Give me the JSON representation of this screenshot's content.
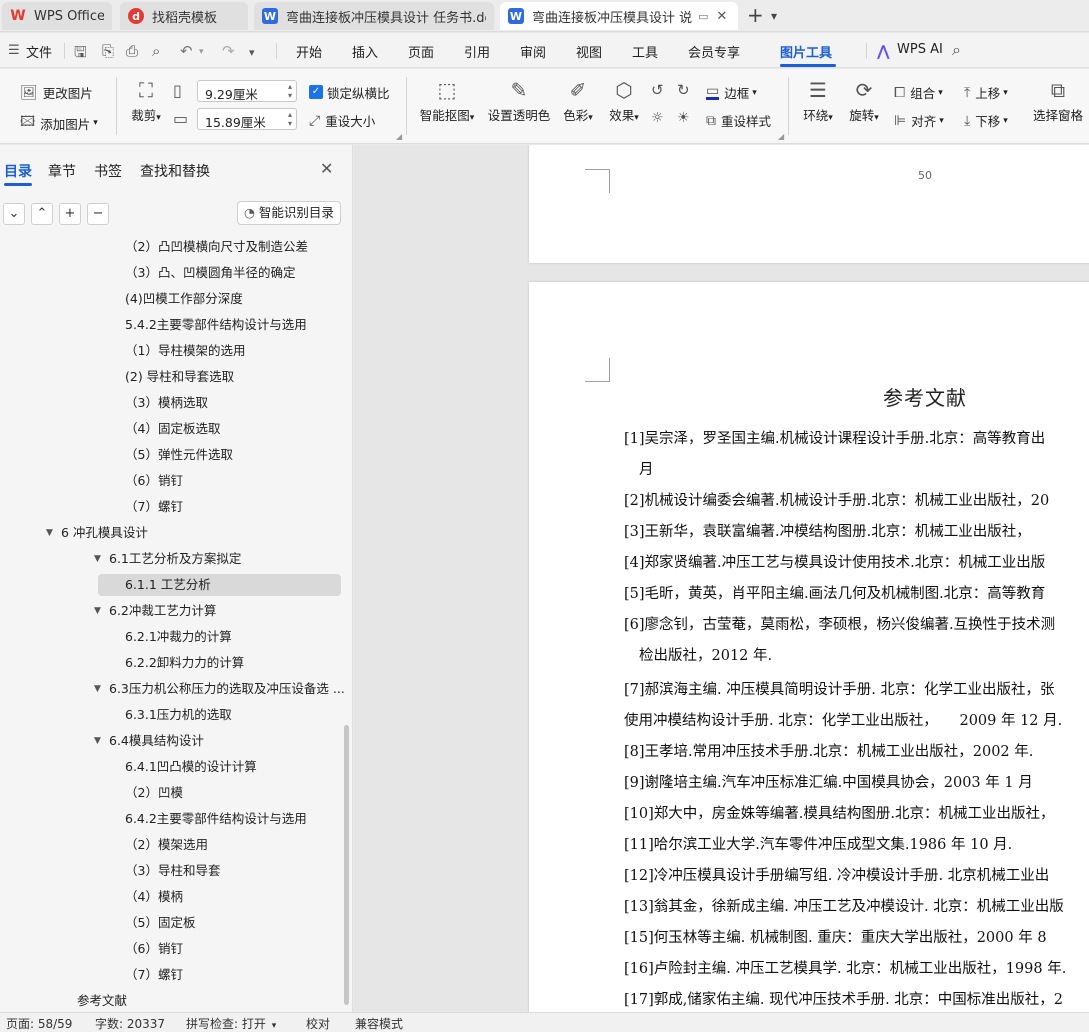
{
  "tabs": [
    {
      "label": "WPS Office",
      "icon": "wps-logo-icon"
    },
    {
      "label": "找稻壳模板",
      "icon": "docer-icon"
    },
    {
      "label": "弯曲连接板冲压模具设计 任务书.doc",
      "icon": "writer-icon"
    },
    {
      "label": "弯曲连接板冲压模具设计 说明",
      "icon": "writer-icon"
    }
  ],
  "titlebar": {
    "new_tab": "+",
    "dropdown": "▾"
  },
  "menu": {
    "file": "文件",
    "items": [
      "开始",
      "插入",
      "页面",
      "引用",
      "审阅",
      "视图",
      "工具",
      "会员专享",
      "图片工具"
    ],
    "active": "图片工具",
    "wps_ai": "WPS AI"
  },
  "ribbon": {
    "change_picture": "更改图片",
    "add_picture": "添加图片",
    "crop": "裁剪",
    "width_value": "9.29厘米",
    "height_value": "15.89厘米",
    "lock_ratio": "锁定纵横比",
    "reset_size": "重设大小",
    "smart_cutout": "智能抠图",
    "set_transparent": "设置透明色",
    "color": "色彩",
    "effects": "效果",
    "border": "边框",
    "reset_style": "重设样式",
    "wrap": "环绕",
    "rotate": "旋转",
    "group": "组合",
    "align": "对齐",
    "bring_forward": "上移",
    "send_backward": "下移",
    "selection_pane": "选择窗格"
  },
  "nav": {
    "tabs": [
      "目录",
      "章节",
      "书签",
      "查找和替换"
    ],
    "smart_toc": "智能识别目录",
    "toc": [
      {
        "text": "（2）凸凹模横向尺寸及制造公差"
      },
      {
        "text": "（3）凸、凹模圆角半径的确定"
      },
      {
        "text": "(4)凹模工作部分深度"
      },
      {
        "text": "5.4.2主要零部件结构设计与选用"
      },
      {
        "text": "（1）导柱模架的选用"
      },
      {
        "text": "(2) 导柱和导套选取"
      },
      {
        "text": "（3）模柄选取"
      },
      {
        "text": "（4）固定板选取"
      },
      {
        "text": "（5）弹性元件选取"
      },
      {
        "text": "（6）销钉"
      },
      {
        "text": "（7）螺钉"
      },
      {
        "text": "6 冲孔模具设计"
      },
      {
        "text": "6.1工艺分析及方案拟定"
      },
      {
        "text": "6.1.1 工艺分析"
      },
      {
        "text": "6.2冲裁工艺力计算"
      },
      {
        "text": "6.2.1冲裁力的计算"
      },
      {
        "text": "6.2.2卸料力力的计算"
      },
      {
        "text": "6.3压力机公称压力的选取及冲压设备选 ..."
      },
      {
        "text": "6.3.1压力机的选取"
      },
      {
        "text": "6.4模具结构设计"
      },
      {
        "text": "6.4.1凹凸模的设计计算"
      },
      {
        "text": "（2）凹模"
      },
      {
        "text": "6.4.2主要零部件结构设计与选用"
      },
      {
        "text": "（2）模架选用"
      },
      {
        "text": "（3）导柱和导套"
      },
      {
        "text": "（4）模柄"
      },
      {
        "text": "（5）固定板"
      },
      {
        "text": "（6）销钉"
      },
      {
        "text": "（7）螺钉"
      },
      {
        "text": "参考文献"
      }
    ]
  },
  "document": {
    "page_number": "50",
    "ref_title": "参考文献",
    "refs": [
      "[1]吴宗泽，罗圣国主编.机械设计课程设计手册.北京：高等教育出",
      "月",
      "[2]机械设计编委会编著.机械设计手册.北京：机械工业出版社，20",
      "[3]王新华，袁联富编著.冲模结构图册.北京：机械工业出版社，",
      "[4]郑家贤编著.冲压工艺与模具设计使用技术.北京：机械工业出版",
      "[5]毛昕，黄英，肖平阳主编.画法几何及机械制图.北京：高等教育",
      "[6]廖念钊，古莹菴，莫雨松，李硕根，杨兴俊编著.互换性于技术测",
      "检出版社，2012 年.",
      "[7]郝滨海主编. 冲压模具简明设计手册. 北京：化学工业出版社，张",
      "使用冲模结构设计手册. 北京：化学工业出版社，　　2009 年 12 月.",
      "[8]王孝培.常用冲压技术手册.北京：机械工业出版社，2002 年.",
      "[9]谢隆培主编.汽车冲压标准汇编.中国模具协会，2003 年  1 月",
      "[10]郑大中，房金姝等编著.模具结构图册.北京：机械工业出版社，",
      "[11]哈尔滨工业大学.汽车零件冲压成型文集.1986 年  10 月.",
      "[12]冷冲压模具设计手册编写组. 冷冲模设计手册. 北京机械工业出",
      "[13]翁其金，徐新成主编. 冲压工艺及冲模设计. 北京：机械工业出版",
      "[15]何玉林等主编.  机械制图. 重庆：重庆大学出版社，2000 年  8",
      "[16]卢险封主编. 冲压工艺模具学. 北京：机械工业出版社，1998 年.",
      "[17]郭成,储家佑主编. 现代冲压技术手册. 北京：中国标准出版社，2"
    ]
  },
  "status": {
    "page": "页面: 58/59",
    "words": "字数: 20337",
    "spell": "拼写检查: 打开",
    "proof": "校对",
    "compat": "兼容模式"
  },
  "colors": {
    "accent": "#1a5fd6",
    "wps_red": "#e53935",
    "writer_blue": "#2f6ae0"
  }
}
